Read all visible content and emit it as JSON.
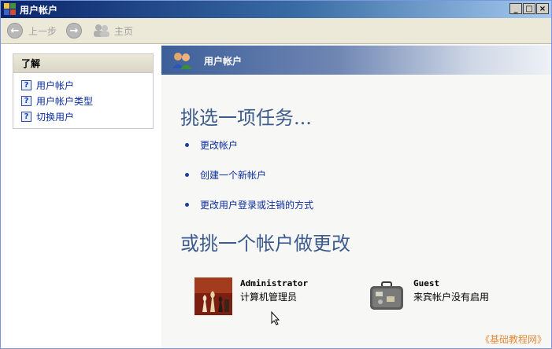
{
  "window": {
    "title": "用户帐户",
    "controls": [
      "minimize",
      "maximize",
      "close"
    ]
  },
  "toolbar": {
    "back_label": "上一步",
    "home_label": "主页"
  },
  "left": {
    "section_title": "了解",
    "items": [
      {
        "label": "用户帐户",
        "icon": "help-icon"
      },
      {
        "label": "用户帐户类型",
        "icon": "help-icon"
      },
      {
        "label": "切换用户",
        "icon": "help-icon"
      }
    ]
  },
  "main": {
    "banner_title": "用户帐户",
    "heading_tasks": "挑选一项任务...",
    "tasks": [
      "更改帐户",
      "创建一个新帐户",
      "更改用户登录或注销的方式"
    ],
    "heading_accounts": "或挑一个帐户做更改",
    "accounts": [
      {
        "name": "Administrator",
        "desc": "计算机管理员",
        "icon": "chess-icon"
      },
      {
        "name": "Guest",
        "desc": "来宾帐户没有启用",
        "icon": "suitcase-icon"
      }
    ]
  },
  "watermark": "《基础教程网》",
  "colors": {
    "link": "#0b2e9f",
    "heading": "#3d5c8e",
    "title_bar": "#0a246a"
  }
}
